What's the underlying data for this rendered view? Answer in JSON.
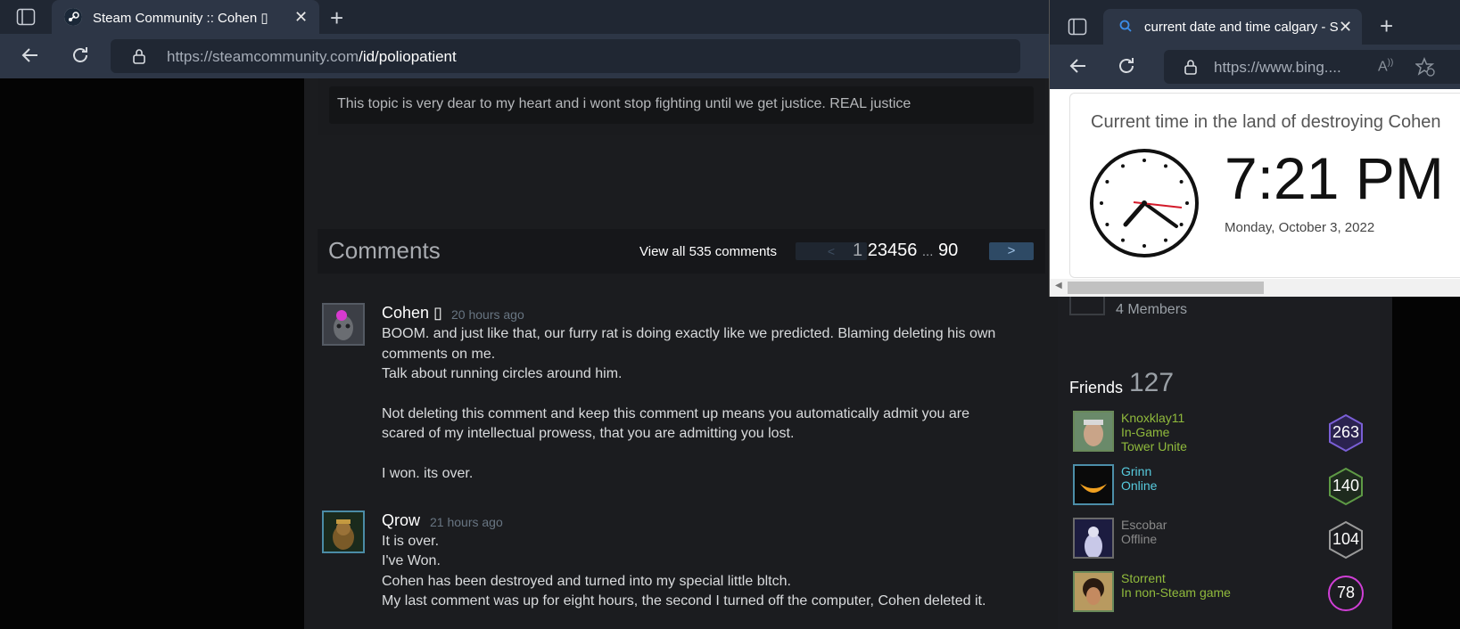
{
  "main_window": {
    "tab_title": "Steam Community :: Cohen ▯",
    "url_host": "https://steamcommunity.com",
    "url_path": "/id/poliopatient"
  },
  "topic": {
    "text": "This topic is very dear to my heart and i wont stop fighting until we get justice. REAL justice"
  },
  "comments": {
    "title": "Comments",
    "view_all": "View all 535 comments",
    "prev_label": "<",
    "next_label": ">",
    "current_page": "1",
    "pages": [
      "2",
      "3",
      "4",
      "5",
      "6"
    ],
    "ellipsis": "...",
    "last_page": "90",
    "items": [
      {
        "author": "Cohen ▯",
        "time": "20 hours ago",
        "lines": [
          "BOOM. and just like that, our furry rat is doing exactly like we predicted. Blaming deleting his own",
          "comments on me.",
          "Talk about running circles around him.",
          "",
          "Not deleting this comment and keep this comment up means you automatically admit you are",
          "scared of my intellectual prowess, that you are admitting you lost.",
          "",
          "I won. its over."
        ]
      },
      {
        "author": "Qrow",
        "time": "21 hours ago",
        "lines": [
          "It is over.",
          "I've Won.",
          "Cohen has been destroyed and turned into my special little bltch.",
          "My last comment was up for eight hours, the second I turned off the computer, Cohen deleted it."
        ]
      }
    ]
  },
  "sidebar": {
    "members": "4 Members",
    "friends_label": "Friends",
    "friends_count": "127",
    "friends": [
      {
        "name": "Knoxklay11",
        "status": "In-Game",
        "game": "Tower Unite",
        "level": "263",
        "color": "#90ba3c",
        "badge_color": "#7a5fd6"
      },
      {
        "name": "Grinn",
        "status": "Online",
        "game": "",
        "level": "140",
        "color": "#57cbde",
        "badge_color": "#5e9a45"
      },
      {
        "name": "Escobar",
        "status": "Offline",
        "game": "",
        "level": "104",
        "color": "#898989",
        "badge_color": "#9a9a9a"
      },
      {
        "name": "Storrent",
        "status": "In non-Steam game",
        "game": "",
        "level": "78",
        "color": "#90ba3c",
        "badge_color": "#d03fd6"
      }
    ]
  },
  "second_window": {
    "tab_title": "current date and time calgary - S",
    "url_host": "https://www.bing....",
    "clock_heading": "Current time in the land of destroying Cohen",
    "time": "7:21 PM",
    "date": "Monday, October 3, 2022"
  },
  "icons": {
    "tab_panel": "tab-panel-icon",
    "back": "back-arrow-icon",
    "reload": "reload-icon",
    "lock": "lock-icon",
    "read_aloud": "read-aloud-icon",
    "favorite_add": "favorite-add-icon",
    "search": "search-icon"
  }
}
